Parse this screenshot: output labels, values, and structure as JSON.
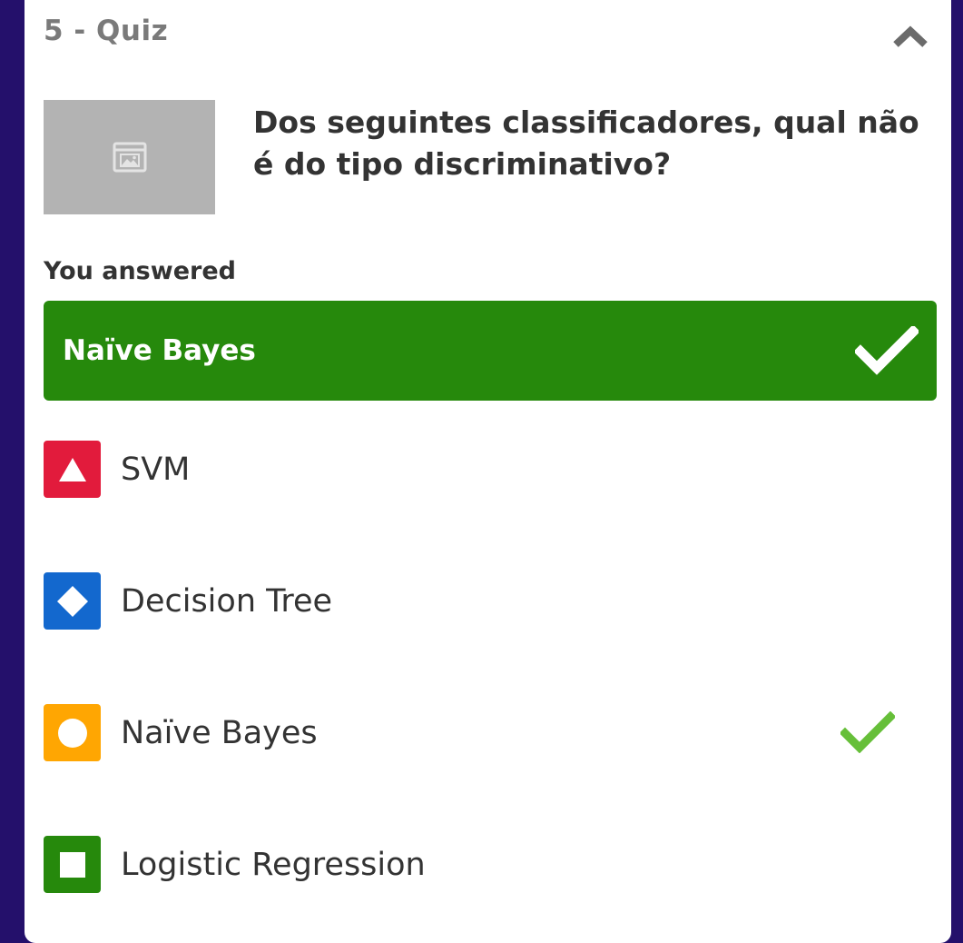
{
  "header": {
    "title": "5 - Quiz",
    "collapse_icon": "chevron-up-icon"
  },
  "question": {
    "image_icon": "image-placeholder-icon",
    "text": "Dos seguintes classificadores, qual não é do tipo discriminativo?"
  },
  "you_answered": {
    "label": "You answered",
    "answer": "Naïve Bayes",
    "status_icon": "checkmark-icon",
    "color": "#26890c"
  },
  "options": [
    {
      "label": "SVM",
      "shape": "triangle-icon",
      "color": "#e21b3c",
      "correct": false
    },
    {
      "label": "Decision Tree",
      "shape": "diamond-icon",
      "color": "#1368ce",
      "correct": false
    },
    {
      "label": "Naïve Bayes",
      "shape": "circle-icon",
      "color": "#ffa602",
      "correct": true
    },
    {
      "label": "Logistic Regression",
      "shape": "square-icon",
      "color": "#26890c",
      "correct": false
    }
  ],
  "colors": {
    "background": "#24106b",
    "correct_check": "#66bf39"
  }
}
